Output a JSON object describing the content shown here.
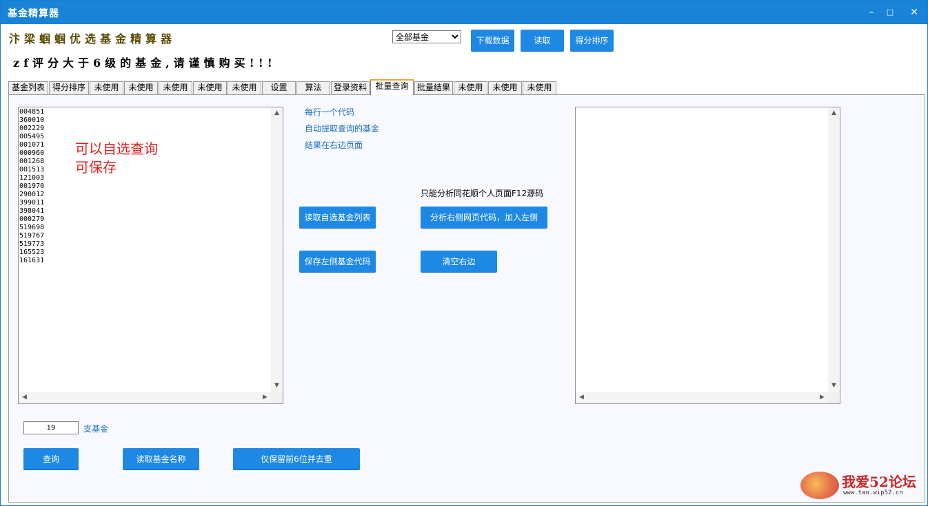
{
  "window": {
    "title": "基金精算器",
    "minimize": "–",
    "maximize": "□",
    "close": "✕"
  },
  "header": {
    "app_title": "汴梁蝈蝈优选基金精算器",
    "warning": "zf评分大于6级的基金,请谨慎购买!!!",
    "fund_filter_selected": "全部基金",
    "download_button": "下载数据",
    "read_button": "读取",
    "score_sort_button": "得分排序"
  },
  "tabs": [
    {
      "label": "基金列表"
    },
    {
      "label": "得分排序"
    },
    {
      "label": "未使用"
    },
    {
      "label": "未使用"
    },
    {
      "label": "未使用"
    },
    {
      "label": "未使用"
    },
    {
      "label": "未使用"
    },
    {
      "label": "设置"
    },
    {
      "label": "算法"
    },
    {
      "label": "登录资料"
    },
    {
      "label": "批量查询",
      "active": true
    },
    {
      "label": "批量结果"
    },
    {
      "label": "未使用"
    },
    {
      "label": "未使用"
    },
    {
      "label": "未使用"
    }
  ],
  "batch": {
    "fund_codes": [
      "004851",
      "360010",
      "002229",
      "005495",
      "001071",
      "000960",
      "001268",
      "001513",
      "121003",
      "001970",
      "290012",
      "399011",
      "398041",
      "000279",
      "519698",
      "519767",
      "519773",
      "165523",
      "161631"
    ],
    "annotation_line1": "可以自选查询",
    "annotation_line2": "可保存",
    "hint_one_per_line": "每行一个代码",
    "hint_auto_extract": "自动提取查询的基金",
    "hint_result_right": "结果在右边页面",
    "read_watchlist_button": "读取自选基金列表",
    "save_left_button": "保存左侧基金代码",
    "analyze_note": "只能分析同花顺个人页面F12源码",
    "analyze_button": "分析右侧网页代码，加入左侧",
    "clear_right_button": "清空右边",
    "fund_count": "19",
    "fund_count_unit": "支基金",
    "query_button": "查询",
    "read_names_button": "读取基金名称",
    "dedupe_button": "仅保留前6位并去重",
    "right_text": ""
  },
  "watermark": {
    "text": "我爱52论坛",
    "url": "www.tao.wip52.cn"
  },
  "colors": {
    "titlebar": "#1883d7",
    "button": "#1e88e5",
    "annotation": "#e0201c",
    "link": "#1a6fbf"
  }
}
